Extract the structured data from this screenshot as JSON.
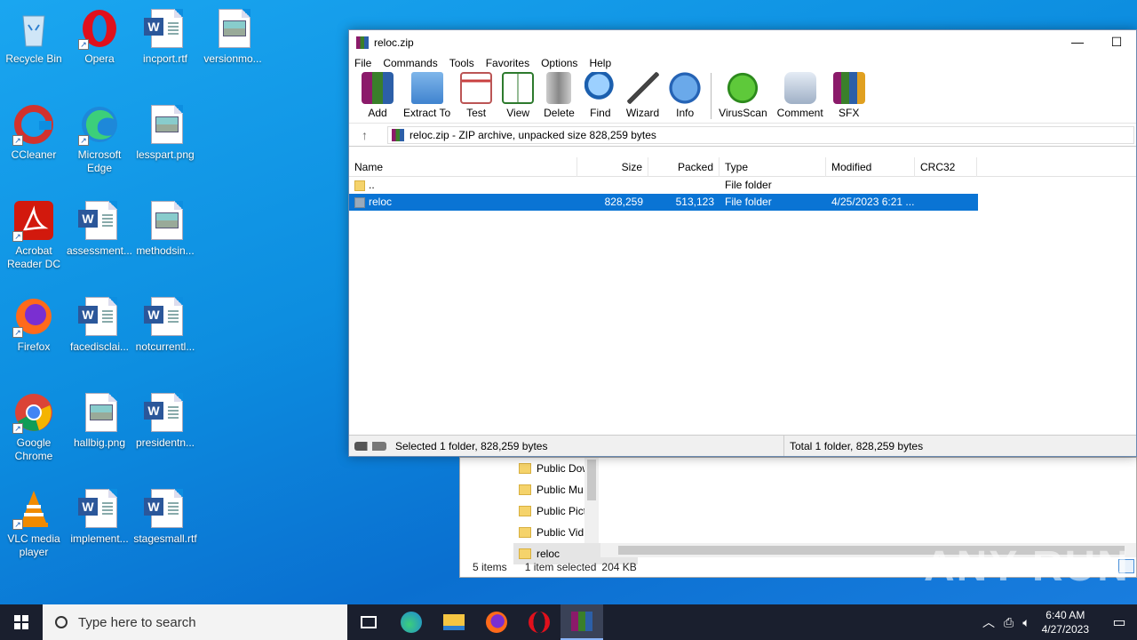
{
  "desktop": {
    "icons": [
      {
        "label": "Recycle Bin"
      },
      {
        "label": "Opera"
      },
      {
        "label": "incport.rtf"
      },
      {
        "label": "versionmo..."
      },
      {
        "label": "CCleaner"
      },
      {
        "label": "Microsoft Edge"
      },
      {
        "label": "lesspart.png"
      },
      {
        "label": "Acrobat Reader DC"
      },
      {
        "label": "assessment..."
      },
      {
        "label": "methodsin..."
      },
      {
        "label": "Firefox"
      },
      {
        "label": "facedisclai..."
      },
      {
        "label": "notcurrentl..."
      },
      {
        "label": "Google Chrome"
      },
      {
        "label": "hallbig.png"
      },
      {
        "label": "presidentn..."
      },
      {
        "label": "VLC media player"
      },
      {
        "label": "implement..."
      },
      {
        "label": "stagesmall.rtf"
      }
    ]
  },
  "winrar": {
    "title": "reloc.zip",
    "minimize": "—",
    "maximize": "☐",
    "menu": [
      "File",
      "Commands",
      "Tools",
      "Favorites",
      "Options",
      "Help"
    ],
    "toolbar": [
      "Add",
      "Extract To",
      "Test",
      "View",
      "Delete",
      "Find",
      "Wizard",
      "Info",
      "VirusScan",
      "Comment",
      "SFX"
    ],
    "up_arrow": "↑",
    "address": "reloc.zip - ZIP archive, unpacked size 828,259 bytes",
    "columns": {
      "name": "Name",
      "size": "Size",
      "packed": "Packed",
      "type": "Type",
      "modified": "Modified",
      "crc": "CRC32"
    },
    "rows": [
      {
        "name": "..",
        "size": "",
        "packed": "",
        "type": "File folder",
        "modified": "",
        "crc": ""
      },
      {
        "name": "reloc",
        "size": "828,259",
        "packed": "513,123",
        "type": "File folder",
        "modified": "4/25/2023 6:21 ...",
        "crc": ""
      }
    ],
    "status_left": "Selected 1 folder, 828,259 bytes",
    "status_right": "Total 1 folder, 828,259 bytes"
  },
  "explorer": {
    "nav": [
      "Public Dow",
      "Public Mu",
      "Public Pict",
      "Public Vid",
      "reloc"
    ],
    "items_count": "5 items",
    "selected": "1 item selected",
    "size": "204 KB"
  },
  "watermark": "ANY RUN",
  "taskbar": {
    "search_placeholder": "Type here to search",
    "time": "6:40 AM",
    "date": "4/27/2023"
  }
}
